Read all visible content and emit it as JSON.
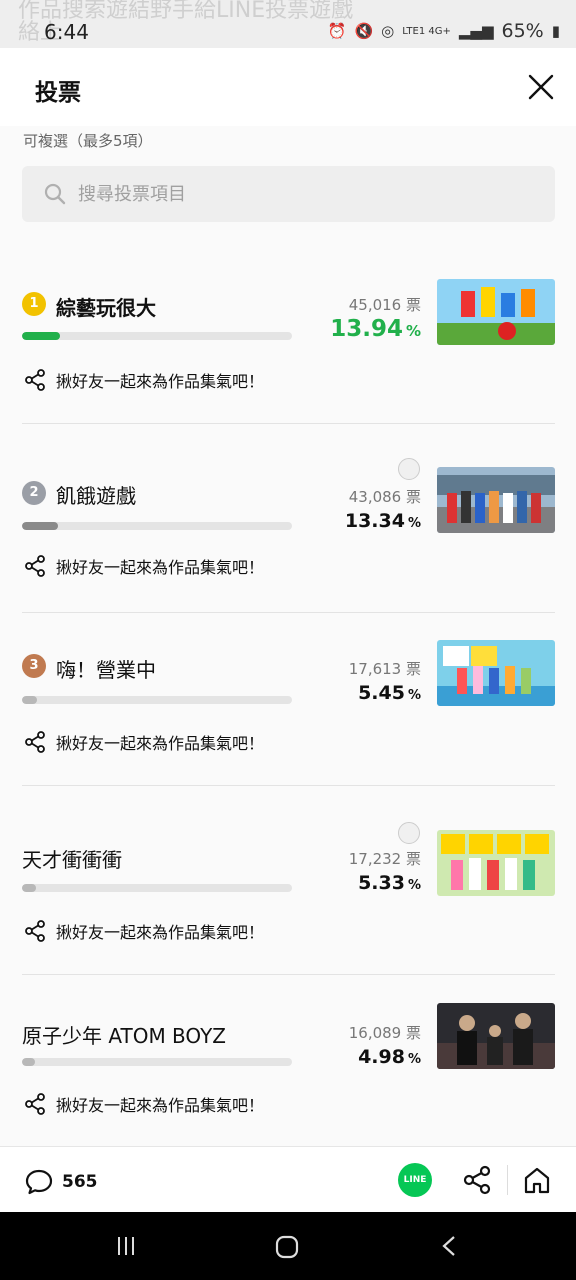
{
  "status_bar": {
    "ghost_text": "作品搜索遊結野手給LINE投票遊戲",
    "ghost_text2": "絡上",
    "time": "6:44",
    "network": "LTE1 4G+",
    "battery": "65%"
  },
  "header": {
    "title": "投票"
  },
  "content": {
    "hint": "可複選（最多5項）",
    "search_placeholder": "搜尋投票項目",
    "share_text": "揪好友一起來為作品集氣吧！",
    "percent_symbol": "%",
    "items": [
      {
        "rank": "1",
        "name": "綜藝玩很大",
        "votes": "45,016 票",
        "percent": "13.94",
        "share_label": "揪好友一起來為作品集氣吧！",
        "bar_fraction": 0.1394,
        "bar_color": "#21b04b"
      },
      {
        "rank": "2",
        "name": "飢餓遊戲",
        "votes": "43,086 票",
        "percent": "13.34",
        "share_label": "揪好友一起來為作品集氣吧！",
        "bar_fraction": 0.1334,
        "bar_color": "#8a8a8a"
      },
      {
        "rank": "3",
        "name": "嗨！營業中",
        "votes": "17,613 票",
        "percent": "5.45",
        "share_label": "揪好友一起來為作品集氣吧！",
        "bar_fraction": 0.0545,
        "bar_color": "#b8b8b8"
      },
      {
        "rank": "",
        "name": "天才衝衝衝",
        "votes": "17,232 票",
        "percent": "5.33",
        "share_label": "揪好友一起來為作品集氣吧！",
        "bar_fraction": 0.0533,
        "bar_color": "#b8b8b8"
      },
      {
        "rank": "",
        "name": "原子少年 ATOM BOYZ",
        "votes": "16,089 票",
        "percent": "4.98",
        "share_label": "揪好友一起來為作品集氣吧！",
        "bar_fraction": 0.0498,
        "bar_color": "#b8b8b8"
      }
    ]
  },
  "bottom_bar": {
    "comment_count": "565",
    "line_label": "LINE"
  },
  "colors": {
    "accent_green": "#21b04b",
    "line_green": "#06c755",
    "gold": "#f2c200",
    "silver": "#9a9ea6",
    "bronze": "#c07a50"
  }
}
